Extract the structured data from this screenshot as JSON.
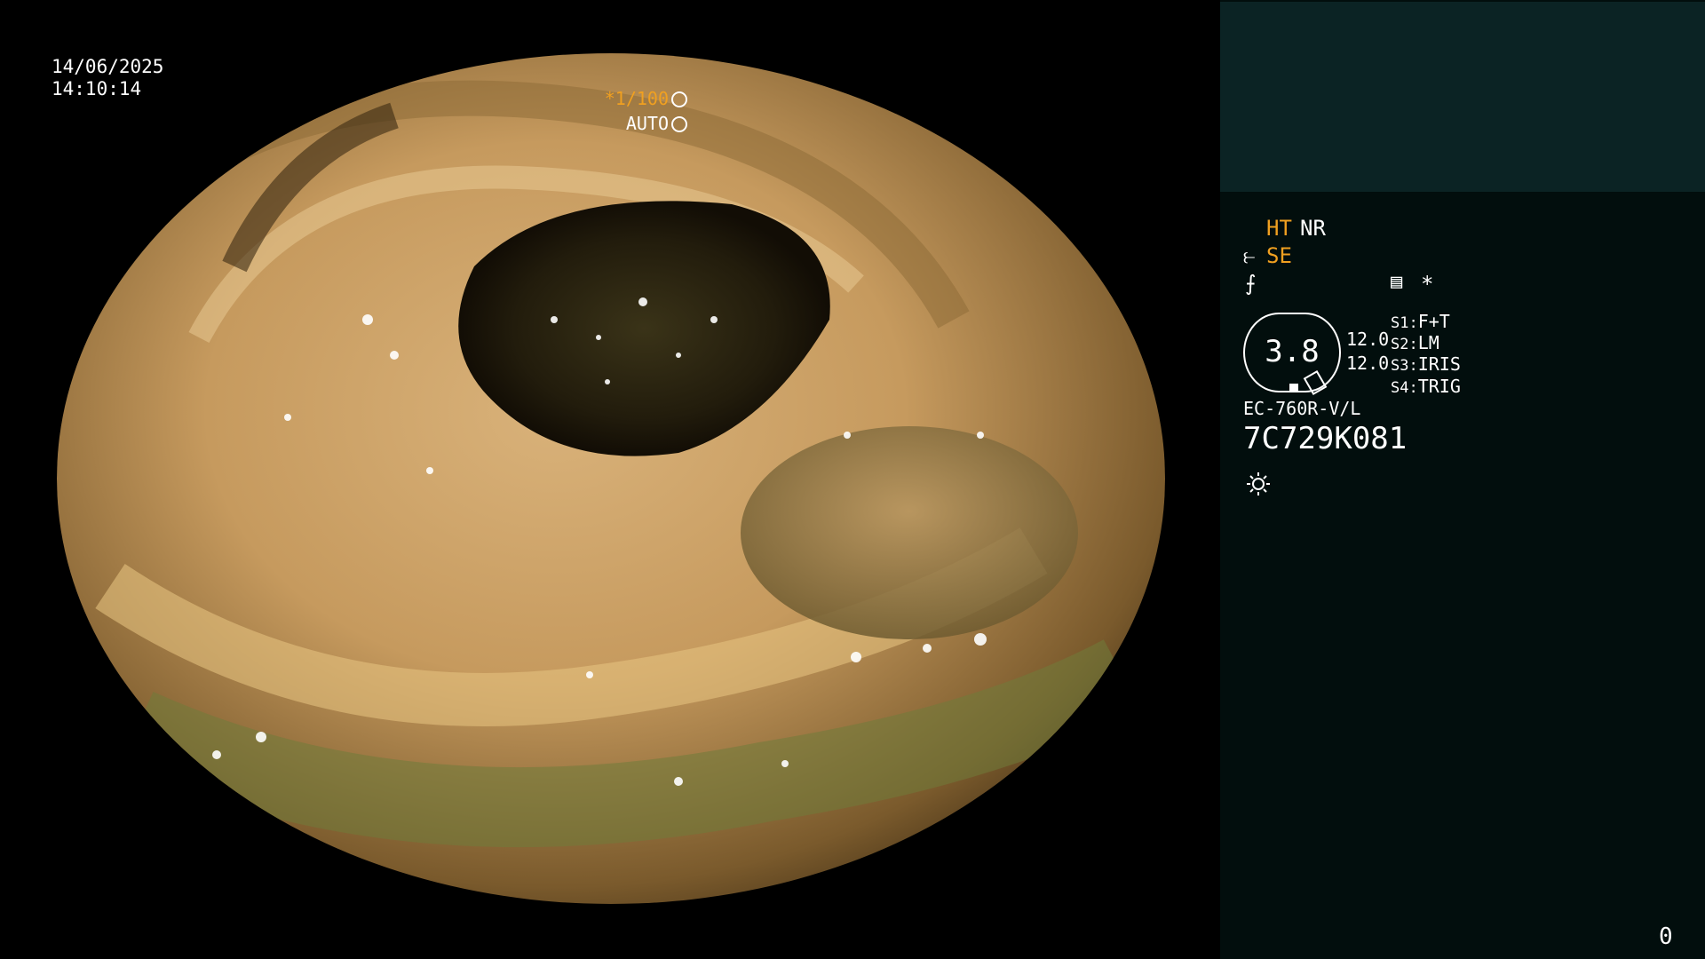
{
  "osd": {
    "date": "14/06/2025",
    "time": "14:10:14",
    "shutter": "*1/100",
    "auto": "AUTO"
  },
  "panel": {
    "ht": "HT",
    "nr": "NR",
    "se": "SE",
    "setting_value": "3.8",
    "value_a": "12.0",
    "value_b": "12.0",
    "s1_key": "S1:",
    "s1_val": "F+T",
    "s2_key": "S2:",
    "s2_val": "LM",
    "s3_key": "S3:",
    "s3_val": "IRIS",
    "s4_key": "S4:",
    "s4_val": "TRIG",
    "model": "EC-760R-V/L",
    "serial": "7C729K081",
    "counter": "0",
    "asterisk": "*"
  },
  "colors": {
    "panel_bg": "#020e0d",
    "panel_top": "#0b2324",
    "accent": "#f0a020"
  }
}
